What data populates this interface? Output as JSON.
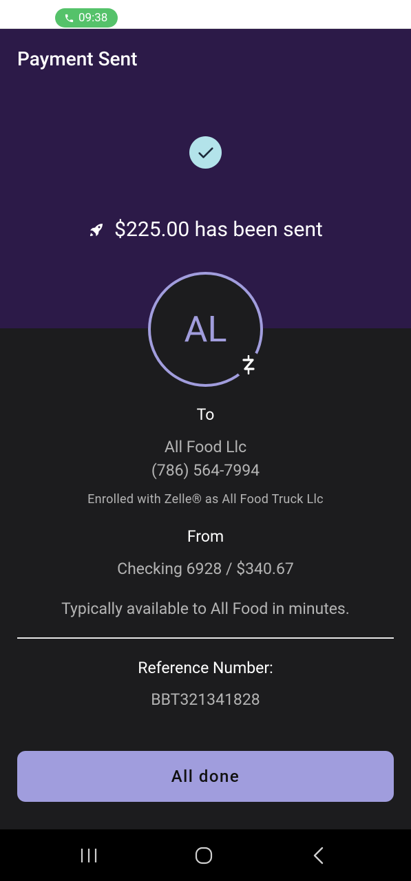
{
  "status_bar": {
    "call_time": "09:38",
    "icon": "phone-icon"
  },
  "header": {
    "title": "Payment Sent",
    "sent_message": "$225.00 has been sent"
  },
  "recipient": {
    "initials": "AL",
    "to_label": "To",
    "name": "All Food Llc",
    "phone": "(786) 564-7994",
    "enrolled_text": "Enrolled with Zelle® as All Food Truck Llc"
  },
  "sender": {
    "from_label": "From",
    "account": "Checking 6928 / $340.67"
  },
  "availability": "Typically available to All Food in minutes.",
  "reference": {
    "label": "Reference Number:",
    "value": "BBT321341828"
  },
  "actions": {
    "done_label": "All done"
  },
  "colors": {
    "header_bg": "#2c1a48",
    "accent": "#a19ddd",
    "check_bg": "#b3e3ea",
    "body_bg": "#1c1c1e"
  }
}
